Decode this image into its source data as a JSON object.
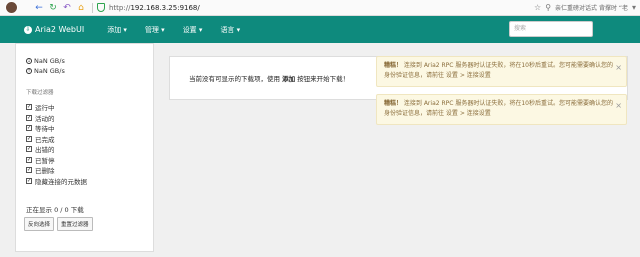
{
  "browser": {
    "url_scheme": "http://",
    "url_host": "192.168.3.25:9168/",
    "right_text": "亲仁重磅对话式 背撑时 “老"
  },
  "navbar": {
    "brand": "Aria2 WebUI",
    "menu": [
      "添加 ▾",
      "管理 ▾",
      "设置 ▾",
      "语言 ▾"
    ],
    "search_placeholder": "搜索"
  },
  "sidebar": {
    "download_speed": "NaN GB/s",
    "upload_speed": "NaN GB/s",
    "filter_title": "下载过滤器",
    "filters": [
      "运行中",
      "活动的",
      "等待中",
      "已完成",
      "出错的",
      "已暂停",
      "已删除",
      "隐藏连接的元数据"
    ],
    "count_text": "正在显示 0 / 0 下载",
    "buttons": [
      "反向选择",
      "重置过滤器"
    ]
  },
  "main": {
    "empty_before": "当前没有可显示的下载项，使用 ",
    "empty_bold": "添加",
    "empty_after": " 按钮来开始下载！"
  },
  "alerts": [
    {
      "title": "糟糕！",
      "text": " 连接到 Aria2 RPC 服务器时认证失败，将在10秒后重试。您可能需要确认您的身份验证信息，请前往 设置 > 连接设置"
    },
    {
      "title": "糟糕！",
      "text": " 连接到 Aria2 RPC 服务器时认证失败，将在10秒后重试。您可能需要确认您的身份验证信息，请前往 设置 > 连接设置"
    }
  ]
}
